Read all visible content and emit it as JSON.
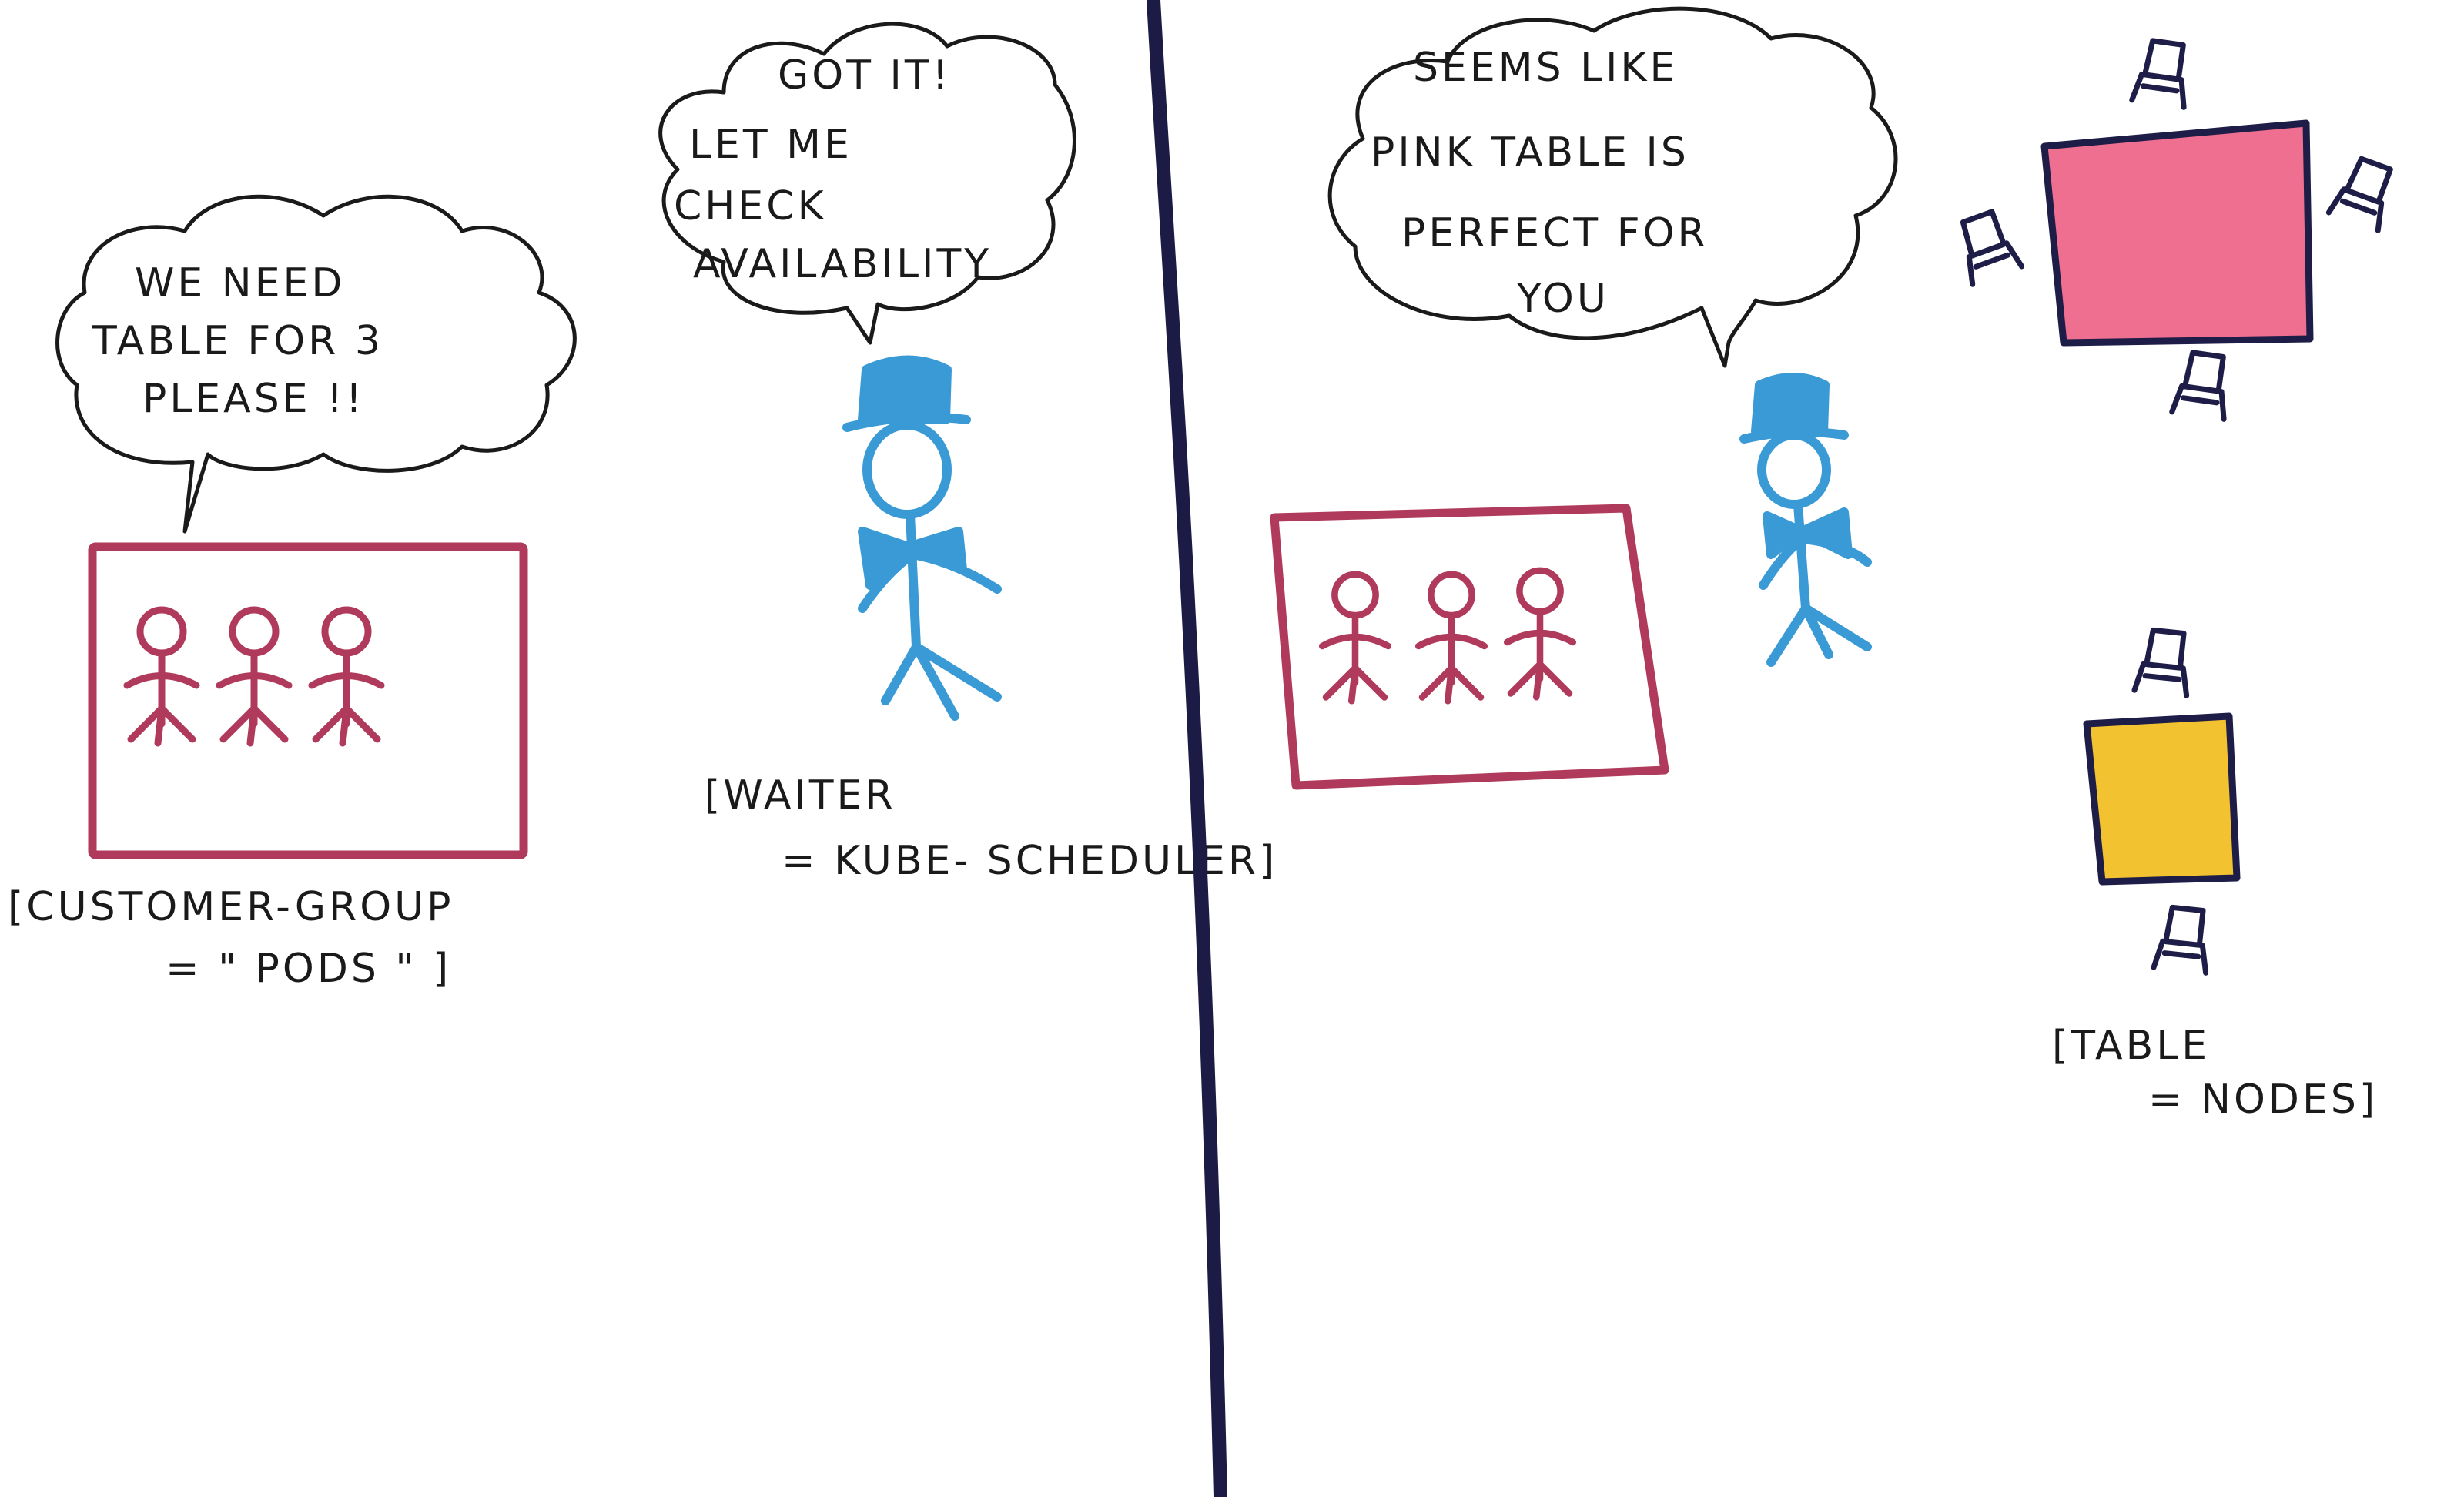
{
  "colors": {
    "ink": "#1a1a1a",
    "divider": "#1c1b45",
    "crowd": "#b03a5b",
    "waiter": "#3a9ad6",
    "pink_table": "#ee6f8f",
    "yellow_table": "#f2c230",
    "chair": "#1e1d48"
  },
  "panel_left": {
    "customer_bubble": [
      "WE NEED",
      "TABLE FOR 3",
      "PLEASE !!"
    ],
    "waiter_bubble": [
      "GOT IT!",
      "LET ME",
      "CHECK",
      "AVAILABILITY"
    ],
    "customer_caption": [
      "[CUSTOMER-GROUP",
      "= \" PODS \" ]"
    ],
    "waiter_caption": [
      "[WAITER",
      "= KUBE- SCHEDULER]"
    ]
  },
  "panel_right": {
    "waiter_bubble": [
      "SEEMS LIKE",
      "PINK TABLE IS",
      "PERFECT FOR",
      "YOU"
    ],
    "table_caption": [
      "[TABLE",
      "= NODES]"
    ]
  },
  "icons": {
    "crowd": "stick-figure-icon",
    "waiter": "waiter-icon",
    "chair": "chair-icon"
  }
}
